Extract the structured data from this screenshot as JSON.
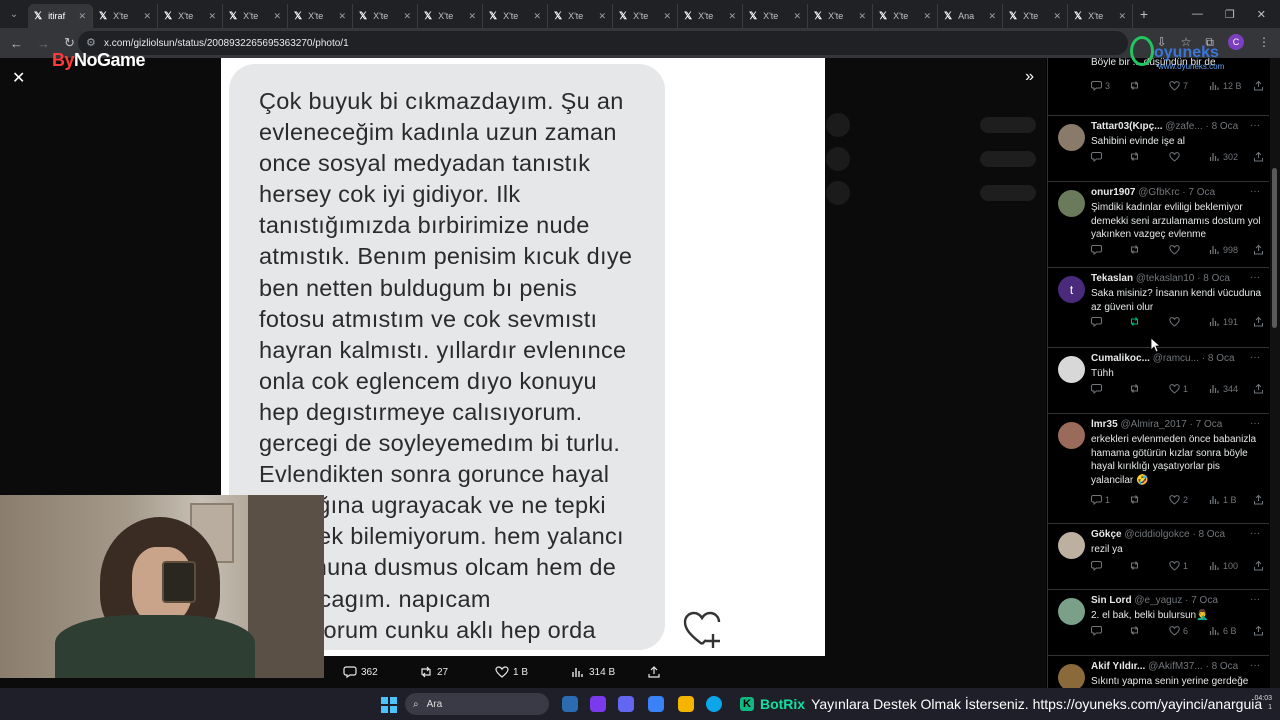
{
  "browser": {
    "tabs": [
      {
        "label": "itiraf",
        "active": true
      },
      {
        "label": "X'te"
      },
      {
        "label": "X'te"
      },
      {
        "label": "X'te"
      },
      {
        "label": "X'te"
      },
      {
        "label": "X'te"
      },
      {
        "label": "X'te"
      },
      {
        "label": "X'te"
      },
      {
        "label": "X'te"
      },
      {
        "label": "X'te"
      },
      {
        "label": "X'te"
      },
      {
        "label": "X'te"
      },
      {
        "label": "X'te"
      },
      {
        "label": "X'te"
      },
      {
        "label": "Ana"
      },
      {
        "label": "X'te"
      },
      {
        "label": "X'te"
      }
    ],
    "url": "x.com/gizliolsun/status/2008932265695363270/photo/1",
    "profile_initial": "C"
  },
  "overlay": {
    "logo_by": "By",
    "logo_rest": "NoGame"
  },
  "watermark": {
    "brand": "oyuneks",
    "domain": "www.oyuneks.com"
  },
  "photo": {
    "lines": [
      "Çok buyuk bi cıkmazdayım. Şu an",
      "evleneceğim kadınla uzun zaman",
      "once sosyal medyadan tanıstık",
      "hersey cok iyi gidiyor. Ilk",
      "tanıstığımızda bırbirimize nude",
      "atmıstık. Benım penisim kıcuk dıye",
      "ben netten buldugum bı penis",
      "fotosu atmıstım ve cok sevmıstı",
      "hayran kalmıstı. yıllardır evlenınce",
      "onla cok eglencem dıyo konuyu",
      "hep degıstırmeye calısıyorum.",
      "gercegi de soyleyemedım bi turlu.",
      "Evlendikten sonra gorunce hayal",
      "kırıklığına ugrayacak ve ne tepki",
      "verecek bilemiyorum. hem yalancı",
      "durumuna dusmus olcam hem de",
      "utanacagım. napıcam",
      "bılmıyorum cunku aklı hep orda"
    ]
  },
  "tweet_actions": {
    "replies": "362",
    "reposts": "27",
    "likes": "1 B",
    "views": "314 B"
  },
  "replies": [
    {
      "name": "",
      "handle": "",
      "date": "",
      "text": "Böyle bir ... düşündün bir de",
      "c": "3",
      "rt": "",
      "lk": "7",
      "vw": "12 B",
      "av": "#3a3a3a"
    },
    {
      "name": "Tattar03(Kıpç...",
      "handle": "@zafe...",
      "date": "8 Oca",
      "text": "Sahibini evinde işe al",
      "c": "",
      "rt": "",
      "lk": "",
      "vw": "302",
      "av": "#8a7a6a"
    },
    {
      "name": "onur1907",
      "handle": "@GfbKrc",
      "date": "7 Oca",
      "text": "Şimdiki kadınlar evliligi beklemiyor demekki seni arzulamamıs dostum yol yakınken vazgeç evlenme",
      "c": "",
      "rt": "",
      "lk": "",
      "vw": "998",
      "av": "#6b7a5a"
    },
    {
      "name": "Tekaslan",
      "handle": "@tekaslan10",
      "date": "8 Oca",
      "text": "Saka misiniz? İnsanın kendi vücuduna az güveni olur",
      "c": "",
      "rt": "",
      "lk": "",
      "vw": "191",
      "av": "#4a2a7a",
      "initial": "t",
      "rt_on": true
    },
    {
      "name": "Cumalikoc...",
      "handle": "@ramcu...",
      "date": "8 Oca",
      "text": "Tühh",
      "c": "",
      "rt": "",
      "lk": "1",
      "vw": "344",
      "av": "#d8d8d8"
    },
    {
      "name": "lmr35",
      "handle": "@Almira_2017",
      "date": "7 Oca",
      "text": "erkekleri evlenmeden önce babanizla hamama götürün kızlar sonra böyle hayal kırıklığı yaşatıyorlar pis yalancilar 🤣",
      "c": "1",
      "rt": "",
      "lk": "2",
      "vw": "1 B",
      "av": "#9a6a5a"
    },
    {
      "name": "Gökçe",
      "handle": "@ciddiolgokce",
      "date": "8 Oca",
      "text": "rezil ya",
      "c": "",
      "rt": "",
      "lk": "1",
      "vw": "100",
      "av": "#bdb0a0"
    },
    {
      "name": "Sin Lord",
      "handle": "@e_yaguz",
      "date": "7 Oca",
      "text": "2. el bak, belki bulursun🤦‍♂️",
      "c": "",
      "rt": "",
      "lk": "6",
      "vw": "6 B",
      "av": "#7aa08a"
    },
    {
      "name": "Akif Yıldır...",
      "handle": "@AkifM37...",
      "date": "8 Oca",
      "text": "Sıkıntı yapma senin yerine gerdeğe",
      "c": "",
      "rt": "",
      "lk": "",
      "vw": "",
      "av": "#8a6a3a"
    }
  ],
  "taskbar": {
    "search_placeholder": "Ara",
    "ticker_brand": "BotRix",
    "ticker_text": "Yayınlara Destek Olmak İsterseniz. https://oyuneks.com/yayinci/anarguia",
    "time": "04:03",
    "date": "1"
  },
  "colors": {
    "background": "#000000",
    "accent_green": "#00ba7c",
    "muted": "#71767b"
  }
}
